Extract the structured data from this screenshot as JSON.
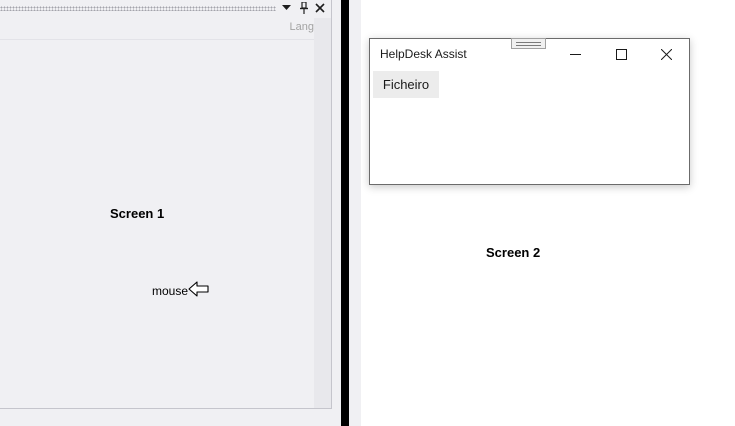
{
  "screen1": {
    "label": "Screen 1",
    "panel": {
      "toolbar_text": "Lang",
      "icons": [
        "chevron-down-icon",
        "pin-icon",
        "close-icon"
      ]
    },
    "mouse": {
      "label": "mouse",
      "icon": "mouse-pointer-icon"
    }
  },
  "screen2": {
    "label": "Screen 2",
    "window": {
      "title": "HelpDesk Assist",
      "menu": [
        {
          "label": "Ficheiro"
        }
      ],
      "controls": [
        "minimize-icon",
        "maximize-icon",
        "close-icon"
      ]
    }
  },
  "colors": {
    "divider": "#000000",
    "panel_bg": "#f0f0f3",
    "window_border": "#6b6b6b"
  }
}
